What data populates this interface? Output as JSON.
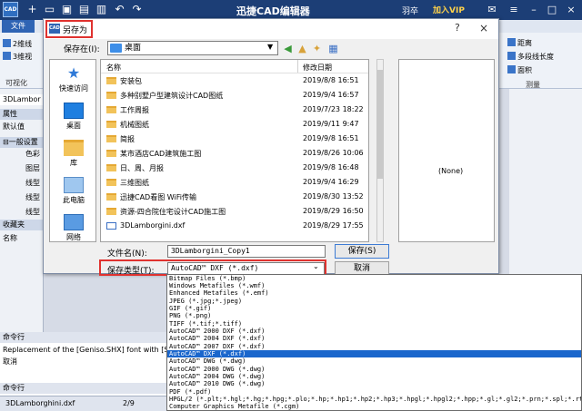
{
  "app": {
    "title": "迅捷CAD编辑器",
    "user": "羽卒",
    "vip": "加入VIP",
    "logo_text": "CAD"
  },
  "ribbon": {
    "file_tab": "文件",
    "left_items": [
      "2维线",
      "3维视",
      "可视化"
    ],
    "right_items": [
      "距离",
      "多段线长度",
      "面积"
    ],
    "right_group": "测量"
  },
  "left_panel": {
    "doc_tab": "3DLambor",
    "properties": "属性",
    "default": "默认值",
    "general": "一般设置",
    "rows": [
      "色彩",
      "图层",
      "线型",
      "线型",
      "线型"
    ],
    "favorites": "收藏夹",
    "name": "名称"
  },
  "command": {
    "header": "命令行",
    "line1": "Replacement of the [Geniso.SHX] font with [SIMPLEX]",
    "line2": "取消",
    "input_header": "命令行"
  },
  "status": {
    "doc": "3DLamborghini.dxf",
    "pages": "2/9"
  },
  "dialog": {
    "title": "另存为",
    "logo_text": "CAD",
    "help": "?",
    "close": "×",
    "save_in_label": "保存在(I):",
    "save_in_value": "桌面",
    "toolbar_icons": [
      "back-icon",
      "up-folder-icon",
      "new-folder-icon",
      "view-menu-icon"
    ],
    "places": [
      {
        "label": "快速访问",
        "icon": "star-icon"
      },
      {
        "label": "桌面",
        "icon": "desktop-icon"
      },
      {
        "label": "库",
        "icon": "library-icon"
      },
      {
        "label": "此电脑",
        "icon": "computer-icon"
      },
      {
        "label": "网络",
        "icon": "network-icon"
      }
    ],
    "columns": {
      "name": "名称",
      "date": "修改日期"
    },
    "files": [
      {
        "name": "安装包",
        "date": "2019/8/8 16:51",
        "type": "folder"
      },
      {
        "name": "多种别墅户型建筑设计CAD图纸",
        "date": "2019/9/4 16:57",
        "type": "folder"
      },
      {
        "name": "工作周报",
        "date": "2019/7/23 18:22",
        "type": "folder"
      },
      {
        "name": "机械图纸",
        "date": "2019/9/11 9:47",
        "type": "folder"
      },
      {
        "name": "简报",
        "date": "2019/9/8 16:51",
        "type": "folder"
      },
      {
        "name": "某市酒店CAD建筑施工图",
        "date": "2019/8/26 10:06",
        "type": "folder"
      },
      {
        "name": "日、周、月报",
        "date": "2019/9/8 16:48",
        "type": "folder"
      },
      {
        "name": "三维图纸",
        "date": "2019/9/4 16:29",
        "type": "folder"
      },
      {
        "name": "迅捷CAD看图 WiFi传输",
        "date": "2019/8/30 13:52",
        "type": "folder"
      },
      {
        "name": "资源-四合院住宅设计CAD施工图",
        "date": "2019/8/29 16:50",
        "type": "folder"
      },
      {
        "name": "3DLamborgini.dxf",
        "date": "2019/8/29 17:55",
        "type": "dxf"
      }
    ],
    "preview": "(None)",
    "file_name_label": "文件名(N):",
    "file_name_value": "3DLamborgini_Copy1",
    "file_type_label": "保存类型(T):",
    "file_type_value": "AutoCAD™ DXF (*.dxf)",
    "save_button": "保存(S)",
    "cancel_button": "取消"
  },
  "dropdown": {
    "selected_index": 10,
    "options": [
      "Bitmap Files (*.bmp)",
      "Windows Metafiles (*.wmf)",
      "Enhanced Metafiles (*.emf)",
      "JPEG (*.jpg;*.jpeg)",
      "GIF (*.gif)",
      "PNG (*.png)",
      "TIFF (*.tif;*.tiff)",
      "AutoCAD™ 2000 DXF (*.dxf)",
      "AutoCAD™ 2004 DXF (*.dxf)",
      "AutoCAD™ 2007 DXF (*.dxf)",
      "AutoCAD™ DXF (*.dxf)",
      "AutoCAD™ DWG (*.dwg)",
      "AutoCAD™ 2000 DWG (*.dwg)",
      "AutoCAD™ 2004 DWG (*.dwg)",
      "AutoCAD™ 2010 DWG (*.dwg)",
      "PDF (*.pdf)",
      "HPGL/2 (*.plt;*.hgl;*.hg;*.hpg;*.plo;*.hp;*.hp1;*.hp2;*.hp3;*.hpgl;*.hpgl2;*.hpp;*.gl;*.gl2;*.prn;*.spl;*.rtl",
      "Computer Graphics Metafile (*.cgm)"
    ]
  }
}
